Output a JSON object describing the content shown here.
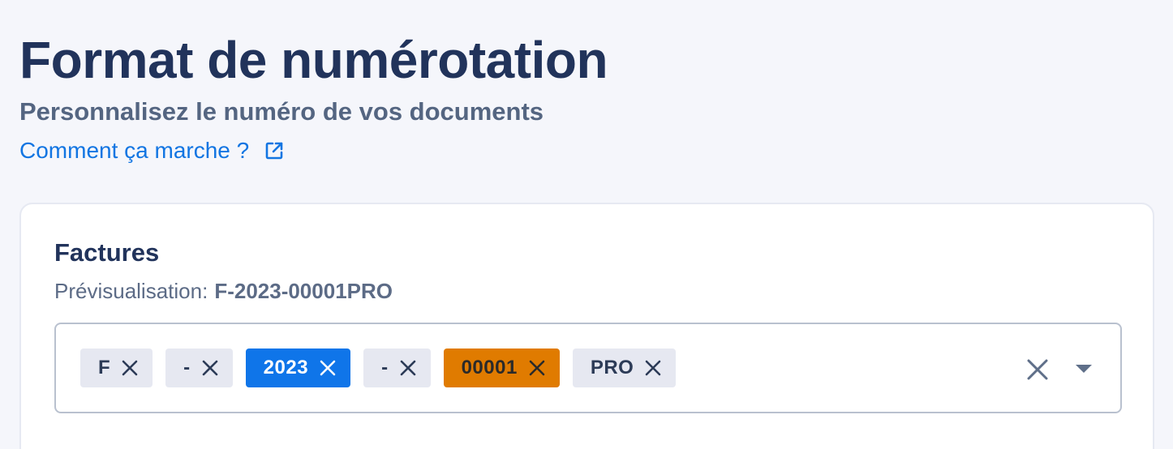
{
  "header": {
    "title": "Format de numérotation",
    "subtitle": "Personnalisez le numéro de vos documents",
    "help_link": "Comment ça marche ?",
    "help_link_icon": "external-link-icon"
  },
  "card": {
    "title": "Factures",
    "preview_label": "Prévisualisation:",
    "preview_value": "F-2023-00001PRO",
    "tags": [
      {
        "label": "F",
        "color": "#e6e8f1"
      },
      {
        "label": "-",
        "color": "#e6e8f1"
      },
      {
        "label": "2023",
        "color": "#0f75e9"
      },
      {
        "label": "-",
        "color": "#e6e8f1"
      },
      {
        "label": "00001",
        "color": "#e07b00"
      },
      {
        "label": "PRO",
        "color": "#e6e8f1"
      }
    ],
    "clear_icon": "close-icon",
    "dropdown_icon": "caret-down-icon"
  },
  "colors": {
    "title": "#21335b",
    "subtitle": "#546581",
    "link": "#1275e2",
    "tag_default": "#e6e8f1",
    "tag_blue": "#0f75e9",
    "tag_orange": "#e07b00"
  }
}
